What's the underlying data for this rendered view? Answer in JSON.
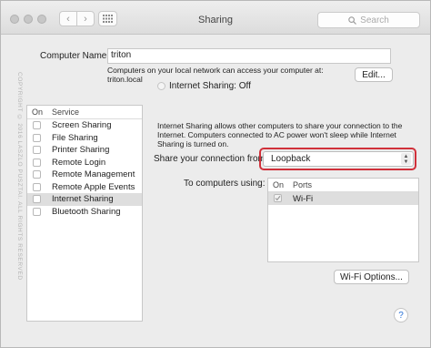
{
  "window": {
    "title": "Sharing",
    "search_placeholder": "Search",
    "nav_back": "‹",
    "nav_forward": "›"
  },
  "watermark": "COPYRIGHT © 2016 LASZLO PUSZTAI. ALL RIGHTS RESERVED",
  "computer_name": {
    "label": "Computer Name:",
    "value": "triton",
    "info_line1": "Computers on your local network can access your computer at:",
    "info_line2": "triton.local",
    "edit_button": "Edit..."
  },
  "services": {
    "col_on": "On",
    "col_service": "Service",
    "items": [
      {
        "label": "Screen Sharing",
        "on": false,
        "selected": false
      },
      {
        "label": "File Sharing",
        "on": false,
        "selected": false
      },
      {
        "label": "Printer Sharing",
        "on": false,
        "selected": false
      },
      {
        "label": "Remote Login",
        "on": false,
        "selected": false
      },
      {
        "label": "Remote Management",
        "on": false,
        "selected": false
      },
      {
        "label": "Remote Apple Events",
        "on": false,
        "selected": false
      },
      {
        "label": "Internet Sharing",
        "on": false,
        "selected": true
      },
      {
        "label": "Bluetooth Sharing",
        "on": false,
        "selected": false
      }
    ]
  },
  "internet_sharing": {
    "status": "Internet Sharing: Off",
    "desc_line1": "Internet Sharing allows other computers to share your connection to the",
    "desc_line2": "Internet. Computers connected to AC power won't sleep while Internet",
    "desc_line3": "Sharing is turned on.",
    "share_from_label": "Share your connection from:",
    "share_from_value": "Loopback",
    "to_computers_label": "To computers using:",
    "ports_col_on": "On",
    "ports_col_ports": "Ports",
    "ports": [
      {
        "label": "Wi-Fi",
        "on": true
      }
    ],
    "wifi_options_button": "Wi-Fi Options..."
  },
  "help_button": "?",
  "colors": {
    "highlight_border": "#d0303a",
    "selected_row": "#dedede",
    "help_glyph": "#2a72d8"
  }
}
